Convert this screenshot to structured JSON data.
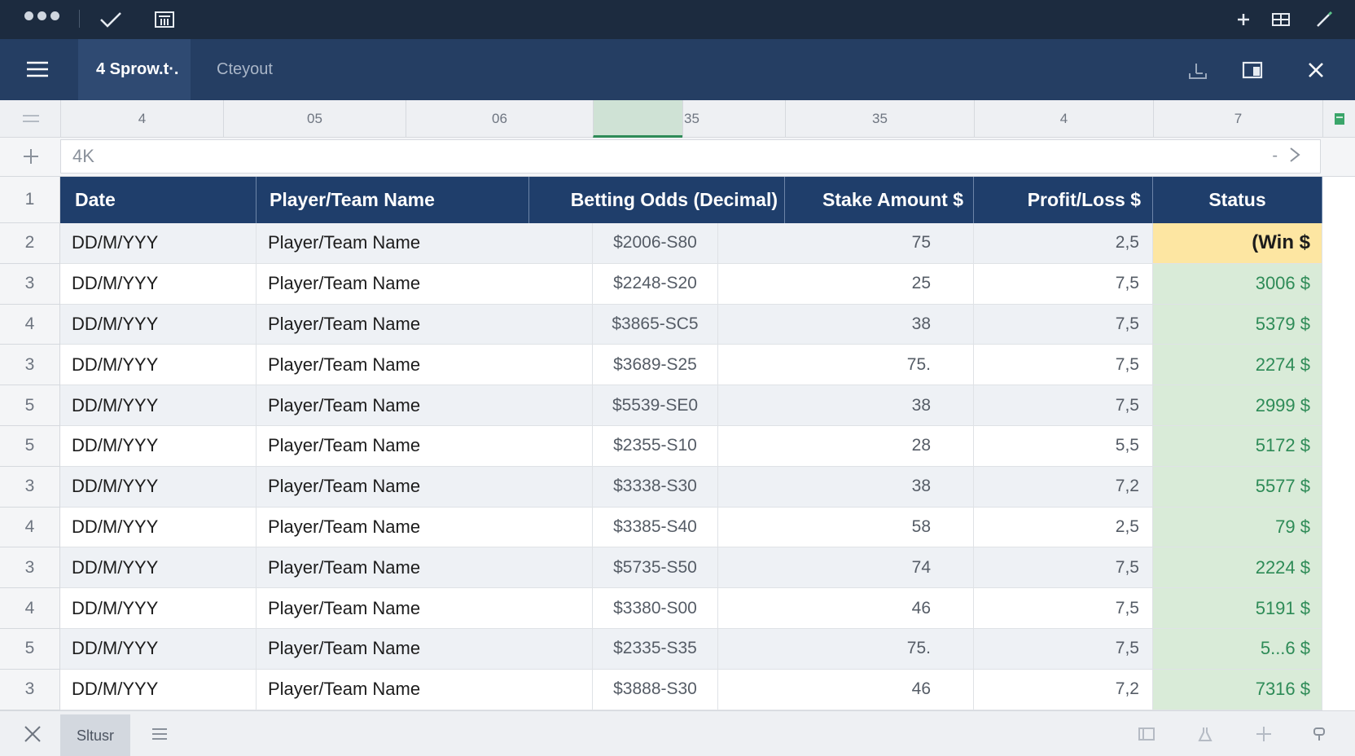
{
  "system_bar": {
    "icons": [
      "window-dots-icon",
      "check-icon",
      "calculator-icon",
      "plus-icon",
      "grid-icon",
      "pen-icon"
    ]
  },
  "app_bar": {
    "tabs": [
      {
        "label": "4 Sprow.t·."
      },
      {
        "label": "Cteyout"
      }
    ],
    "icons": [
      "menu-icon",
      "share-icon",
      "window-icon",
      "close-icon"
    ]
  },
  "column_headers": [
    "4",
    "05",
    "06",
    "35",
    "35",
    "4",
    "7"
  ],
  "formula_bar": {
    "value": "4K",
    "dash": "-"
  },
  "table": {
    "headers": [
      "Date",
      "Player/Team Name",
      "Betting Odds (Decimal)",
      "Stake Amount $",
      "Profit/Loss $",
      "Status"
    ],
    "header_row_number": "1",
    "rows": [
      {
        "n": "2",
        "date": "DD/M/YYY",
        "name": "Player/Team Name",
        "odds": "$2006-S80",
        "stake": "75",
        "pl": "2,5",
        "status": "(Win $"
      },
      {
        "n": "3",
        "date": "DD/M/YYY",
        "name": "Player/Team Name",
        "odds": "$2248-S20",
        "stake": "25",
        "pl": "7,5",
        "status": "3006 $"
      },
      {
        "n": "4",
        "date": "DD/M/YYY",
        "name": "Player/Team Name",
        "odds": "$3865-SC5",
        "stake": "38",
        "pl": "7,5",
        "status": "5379 $"
      },
      {
        "n": "3",
        "date": "DD/M/YYY",
        "name": "Player/Team Name",
        "odds": "$3689-S25",
        "stake": "75.",
        "pl": "7,5",
        "status": "2274 $"
      },
      {
        "n": "5",
        "date": "DD/M/YYY",
        "name": "Player/Team Name",
        "odds": "$5539-SE0",
        "stake": "38",
        "pl": "7,5",
        "status": "2999 $"
      },
      {
        "n": "5",
        "date": "DD/M/YYY",
        "name": "Player/Team Name",
        "odds": "$2355-S10",
        "stake": "28",
        "pl": "5,5",
        "status": "5172 $"
      },
      {
        "n": "3",
        "date": "DD/M/YYY",
        "name": "Player/Team Name",
        "odds": "$3338-S30",
        "stake": "38",
        "pl": "7,2",
        "status": "5577 $"
      },
      {
        "n": "4",
        "date": "DD/M/YYY",
        "name": "Player/Team Name",
        "odds": "$3385-S40",
        "stake": "58",
        "pl": "2,5",
        "status": "79 $"
      },
      {
        "n": "3",
        "date": "DD/M/YYY",
        "name": "Player/Team Name",
        "odds": "$5735-S50",
        "stake": "74",
        "pl": "7,5",
        "status": "2224 $"
      },
      {
        "n": "4",
        "date": "DD/M/YYY",
        "name": "Player/Team Name",
        "odds": "$3380-S00",
        "stake": "46",
        "pl": "7,5",
        "status": "5191 $"
      },
      {
        "n": "5",
        "date": "DD/M/YYY",
        "name": "Player/Team Name",
        "odds": "$2335-S35",
        "stake": "75.",
        "pl": "7,5",
        "status": "5...6 $"
      },
      {
        "n": "3",
        "date": "DD/M/YYY",
        "name": "Player/Team Name",
        "odds": "$3888-S30",
        "stake": "46",
        "pl": "7,2",
        "status": "7316 $"
      }
    ]
  },
  "bottom_bar": {
    "sheet_tab": "Sltusr",
    "icons": [
      "tools-icon",
      "list-icon",
      "layout-icon",
      "flask-icon",
      "add-icon",
      "brush-icon"
    ]
  },
  "colors": {
    "system_bar": "#1c2b3f",
    "app_bar": "#253e63",
    "header": "#1f3e6b",
    "status_win": "#fde6a2",
    "status_green": "#d9ebd8",
    "status_text": "#2e8b57"
  }
}
